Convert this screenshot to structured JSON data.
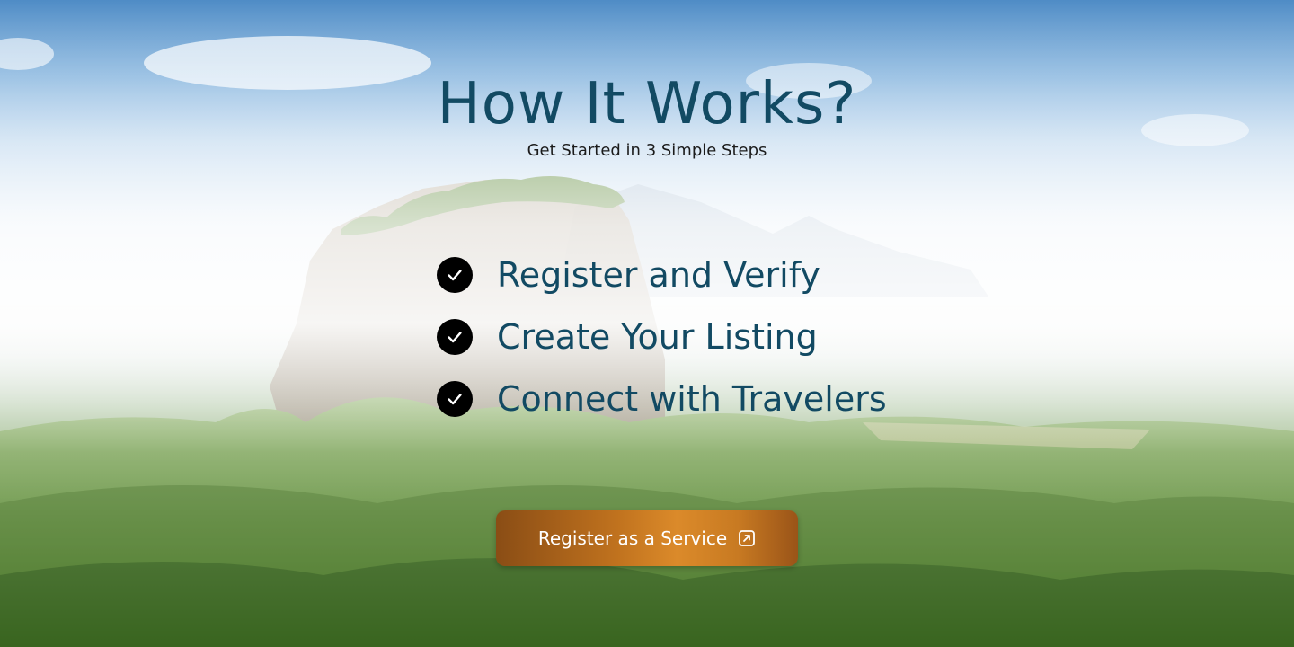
{
  "hero": {
    "title": "How It Works?",
    "subtitle": "Get Started in 3 Simple Steps"
  },
  "steps": [
    {
      "label": "Register and Verify",
      "icon": "check-icon"
    },
    {
      "label": "Create Your Listing",
      "icon": "check-icon"
    },
    {
      "label": "Connect with Travelers",
      "icon": "check-icon"
    }
  ],
  "cta": {
    "label": "Register as a Service",
    "icon": "external-link-icon"
  },
  "colors": {
    "title": "#124a63",
    "button_accent": "#db8a2a"
  }
}
